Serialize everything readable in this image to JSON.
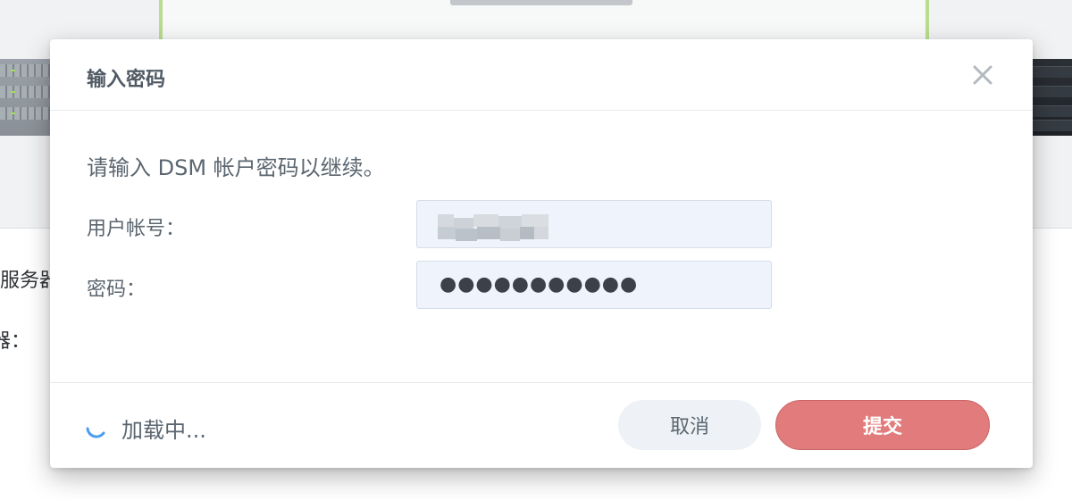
{
  "background": {
    "partial_label_1": "服务器",
    "partial_label_2": "器："
  },
  "dialog": {
    "title": "输入密码",
    "close_icon": "close-icon",
    "instruction": "请输入 DSM 帐户密码以继续。",
    "username": {
      "label": "用户帐号：",
      "value_obscured": true
    },
    "password": {
      "label": "密码：",
      "masked_value": "●●●●●●●●●●●"
    },
    "footer": {
      "loading_icon": "spinner-icon",
      "loading_text": "加载中...",
      "cancel_label": "取消",
      "submit_label": "提交"
    }
  },
  "colors": {
    "submit_button": "#e27c7c",
    "cancel_button": "#eef2f6",
    "input_background": "#eff4fc",
    "spinner": "#4a9df0",
    "background_card_border": "#b9dc8f"
  }
}
